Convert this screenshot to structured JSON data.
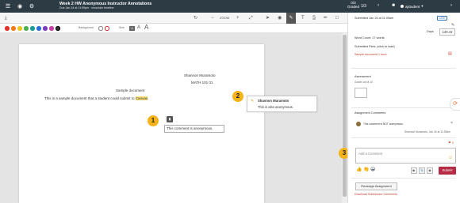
{
  "header": {
    "title": "Week 2 HW Anonymous Instructor Annotations",
    "subtitle": "Due Jan 14 at 11:59pm · mountain timeline",
    "graded_count": "0/3",
    "graded_label": "Graded",
    "student_position": "1/3",
    "student_name": "ajstudent",
    "icons": [
      "download-icon",
      "eye-icon",
      "settings-icon",
      "prev-icon",
      "next-icon",
      "user-icon"
    ]
  },
  "toolbar": {
    "zoom_label": "ZOOM",
    "icons": [
      "download-icon",
      "rotate-icon",
      "zoom-out-icon",
      "zoom-in-icon",
      "expand-icon",
      "pointer-icon",
      "point-annotation-icon",
      "highlight-icon",
      "text-icon",
      "strikeout-icon",
      "freedraw-icon",
      "area-icon"
    ]
  },
  "colorbar": {
    "colors": [
      "#e0322c",
      "#f07c17",
      "#e8c61c",
      "#4caf50",
      "#1a9a9a",
      "#2a6fd6",
      "#7a3fbf",
      "#c83fa8",
      "#333333"
    ],
    "background_label": "Background",
    "size_label": "Size",
    "size_value": "A"
  },
  "document": {
    "author_name": "Shannon Muramoto",
    "course": "MATH 101 01",
    "title": "Sample document",
    "body_before": "This is a sample document that a student could submit to ",
    "body_highlight": "Canvas",
    "body_after": ".",
    "tooltip_comment": "This comment is anonymous.",
    "annotation_card": {
      "name": "Shannon Muramoto",
      "text": "This is also anonymous."
    }
  },
  "badges": [
    "1",
    "2",
    "3"
  ],
  "sidepanel": {
    "submitted": "Submitted Jan 26 at 11:09am",
    "late_badge": "LATE",
    "days_label": "Days",
    "days_value": "140.42",
    "word_count": "Word Count: 17 words",
    "submitted_files": "Submitted Files: (click to load)",
    "file_link": "Sample document 1.docx",
    "assessment_label": "Assessment",
    "grade_label": "Grade out of 10",
    "comments_label": "Assignment Comments",
    "comment_text": "This comment is NOT anonymous.",
    "comment_meta": "Shannon Muramoto, Jan 26 at 11:35am",
    "comment_placeholder": "Add a Comment",
    "comment_count": "0",
    "submit_label": "Submit",
    "reassign_label": "Reassign Assignment",
    "download_link": "Download Submission Comments"
  },
  "colors": {
    "topbar": "#2d3b45",
    "badge": "#f4b31a",
    "submit": "#b52b43",
    "link": "#c0392b",
    "highlight": "#ffe27a"
  }
}
